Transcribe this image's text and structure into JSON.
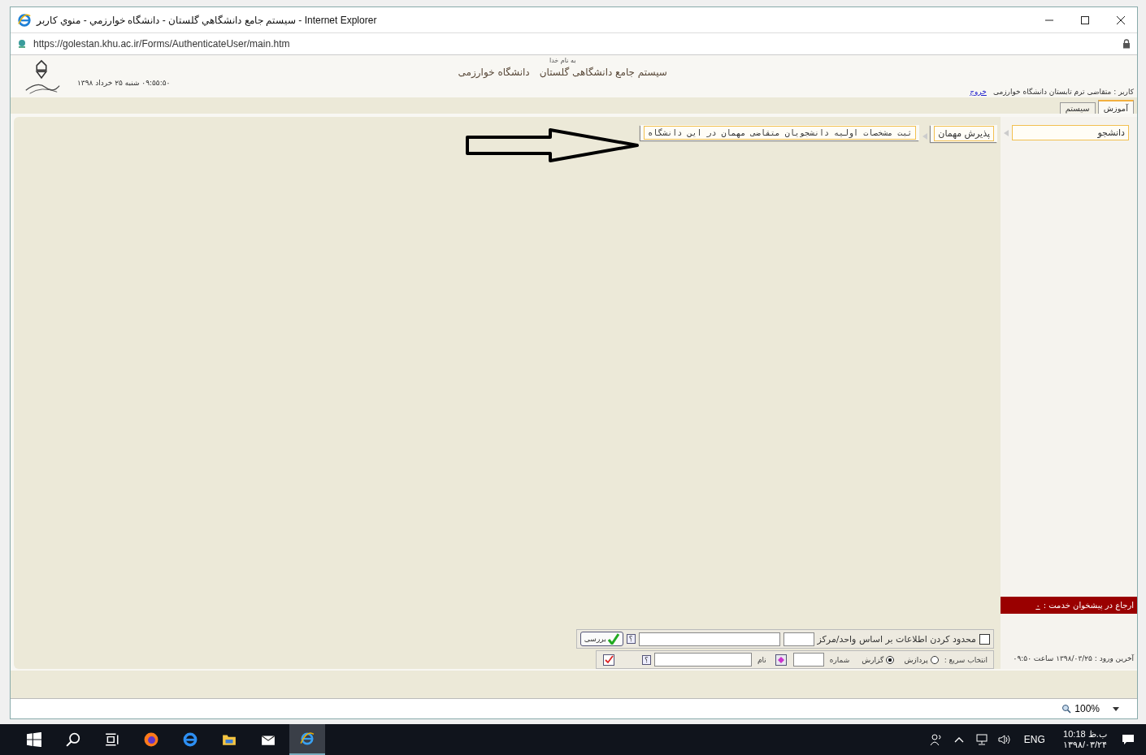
{
  "window": {
    "title": "سيستم جامع دانشگاهي گلستان - دانشگاه خوارزمي - منوي کاربر - Internet Explorer"
  },
  "address_bar": {
    "url": "https://golestan.khu.ac.ir/Forms/AuthenticateUser/main.htm"
  },
  "header": {
    "basmala": "به نام خدا",
    "system_title": "سيستم جامع دانشگاهی گلستان",
    "university": "دانشگاه خوارزمی",
    "datetime": "۰۹:۵۵:۵۰ شنبه ۲۵ خرداد ۱۳۹۸",
    "user": "کاربر : متقاضی ترم تابستان دانشگاه خوارزمی",
    "logout": "خروج"
  },
  "tabs": [
    {
      "label": "آموزش",
      "selected": true
    },
    {
      "label": "سیستم",
      "selected": false
    }
  ],
  "menu_path": [
    "دانشجو",
    "پذیرش مهمان",
    "ثبت مشخصات اولیه دانشجویان متقاضی مهمان در این دانشگاه"
  ],
  "service_panel": {
    "label": "ارجاع در پیشخوان خدمت :",
    "link": "٠"
  },
  "last_login": "آخرین ورود : ۱۳۹۸/۰۳/۲۵ ساعت ۰۹:۵۰",
  "filter": {
    "checked": false,
    "label": "محدود کردن اطلاعات بر اساس واحد/مرکز",
    "help": "؟",
    "button": "بررسی"
  },
  "quick_select": {
    "label": "انتخاب سریع :",
    "options": [
      {
        "label": "پردازش",
        "selected": false
      },
      {
        "label": "گزارش",
        "selected": true
      }
    ],
    "number_label": "شماره",
    "name_label": "نام",
    "help": "؟"
  },
  "status_bar": {
    "zoom": "100%"
  },
  "taskbar": {
    "language": "ENG",
    "time": "10:18 ب.ظ",
    "date": "۱۳۹۸/۰۳/۲۴"
  }
}
